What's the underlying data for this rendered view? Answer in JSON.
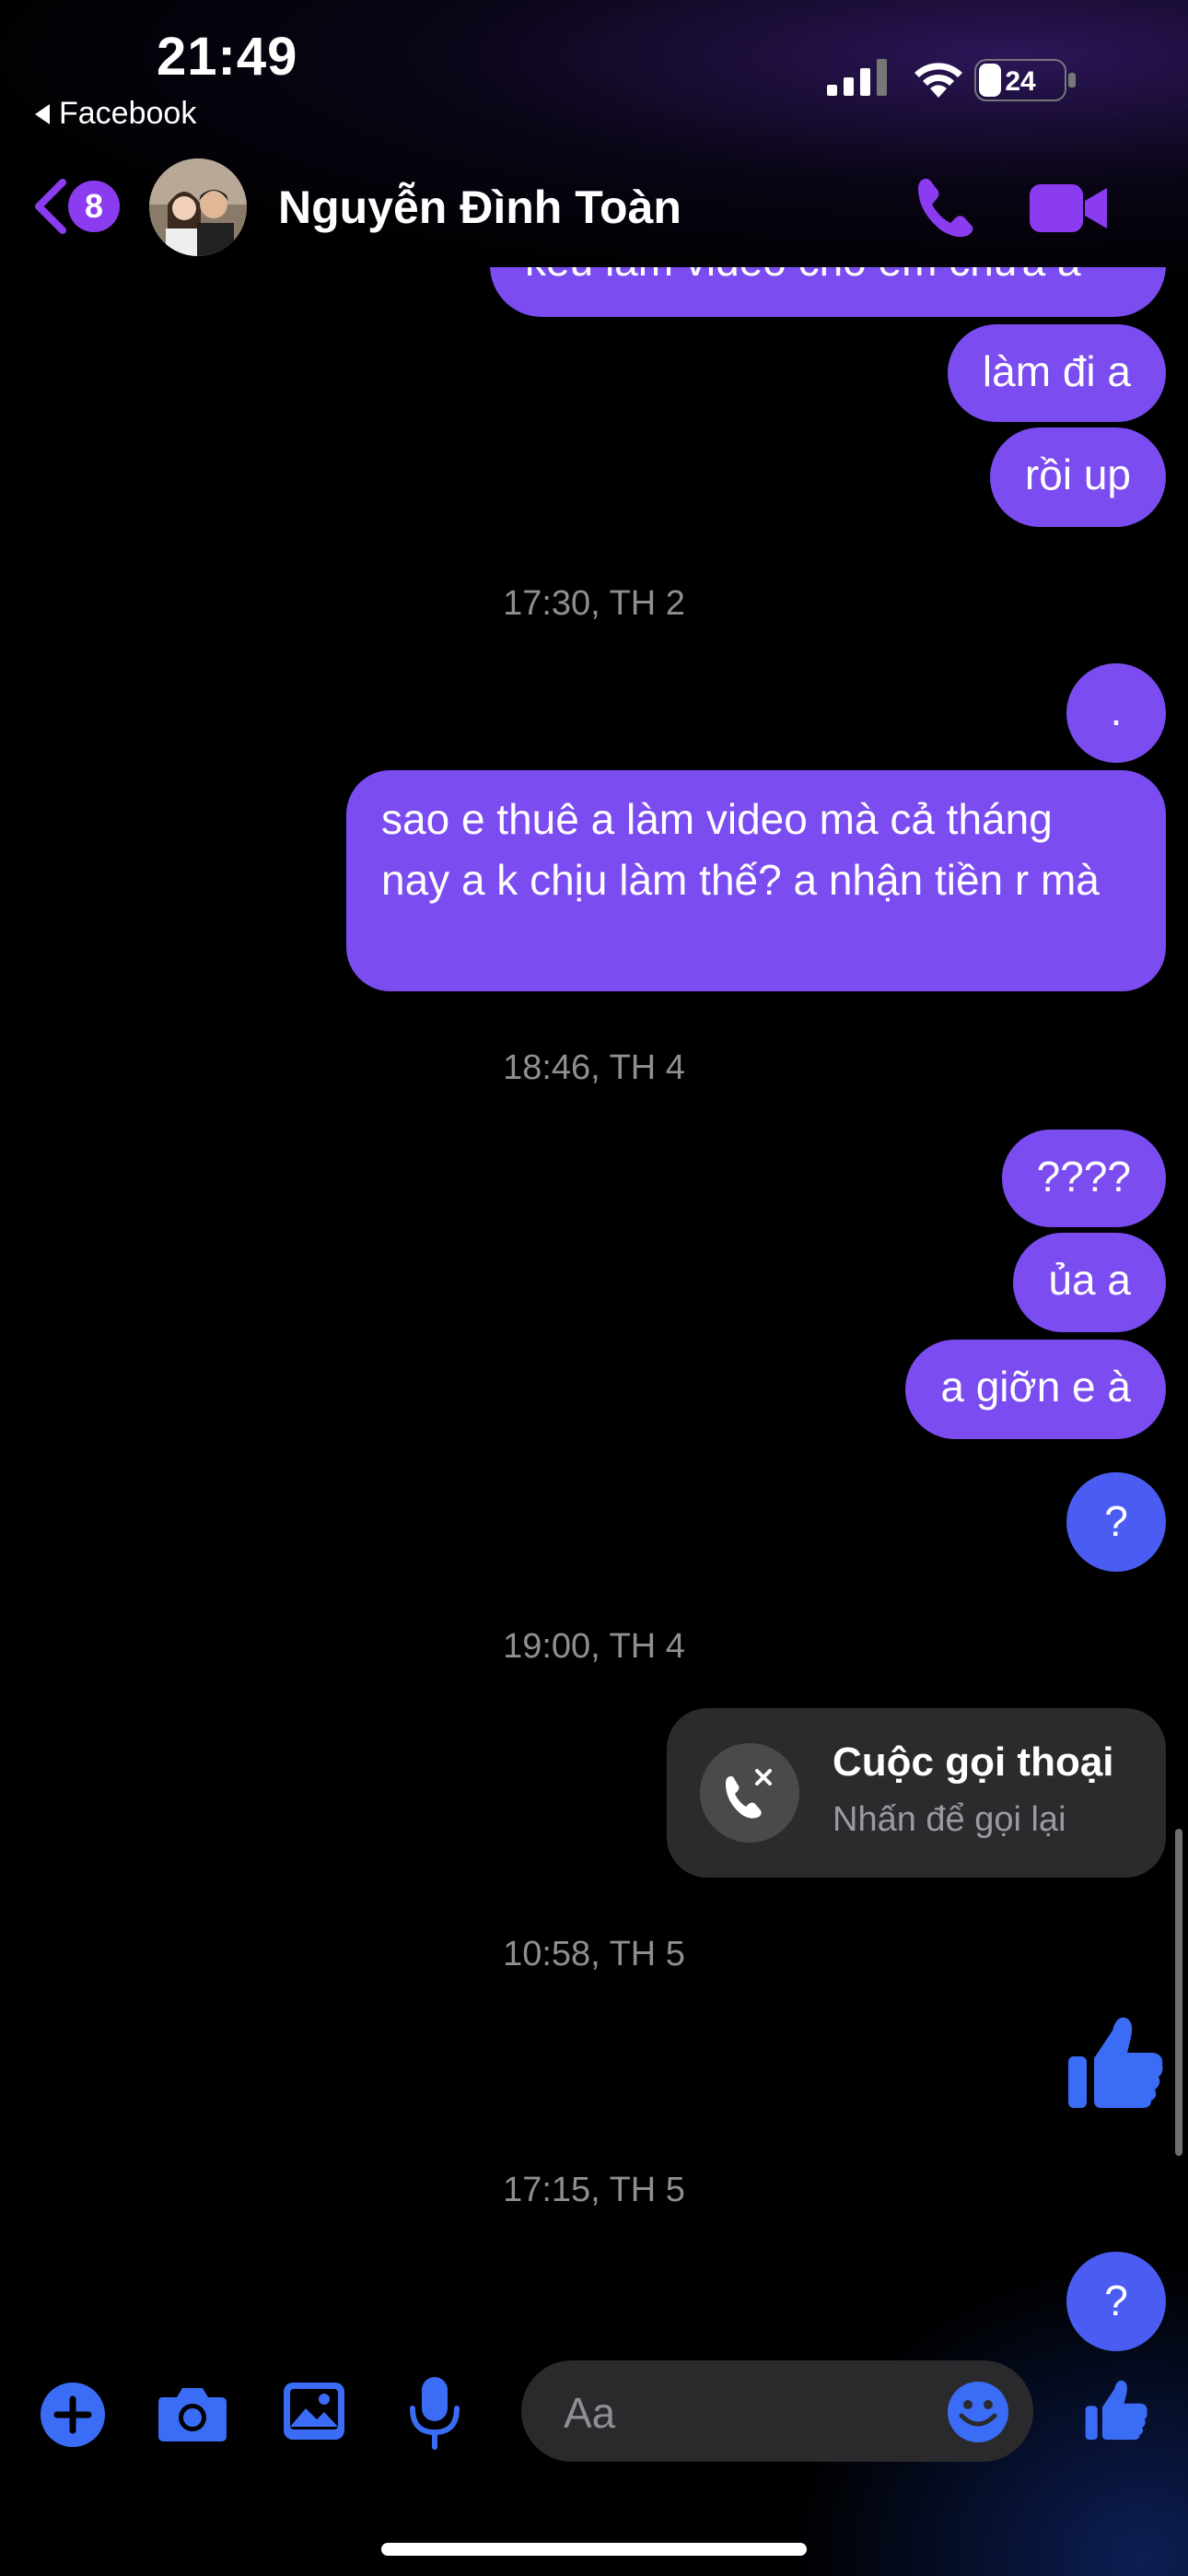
{
  "status_bar": {
    "time": "21:49",
    "back_app": "Facebook",
    "battery": "24"
  },
  "header": {
    "unread_count": "8",
    "contact_name": "Nguyễn Đình Toàn"
  },
  "messages": {
    "m0": "kêu làm video cho em chưa a",
    "m1": "làm đi a",
    "m2": "rồi up",
    "ts1": "17:30, TH 2",
    "m3": ".",
    "m4": "sao e thuê a làm video mà cả tháng nay a k chịu làm thế? a nhận tiền r mà",
    "ts2": "18:46, TH 4",
    "m5": "????",
    "m6": "ủa a",
    "m7": "a giỡn e à",
    "m8": "?",
    "ts3": "19:00, TH 4",
    "call_title": "Cuộc gọi thoại",
    "call_sub": "Nhấn để gọi lại",
    "ts4": "10:58, TH 5",
    "ts5": "17:15, TH 5",
    "m9": "?"
  },
  "composer": {
    "placeholder": "Aa"
  },
  "colors": {
    "accent_purple": "#7b4cf0",
    "accent_blue": "#4a5cf2",
    "icon_blue": "#3b6cf5",
    "badge_purple": "#8b3cf0"
  }
}
